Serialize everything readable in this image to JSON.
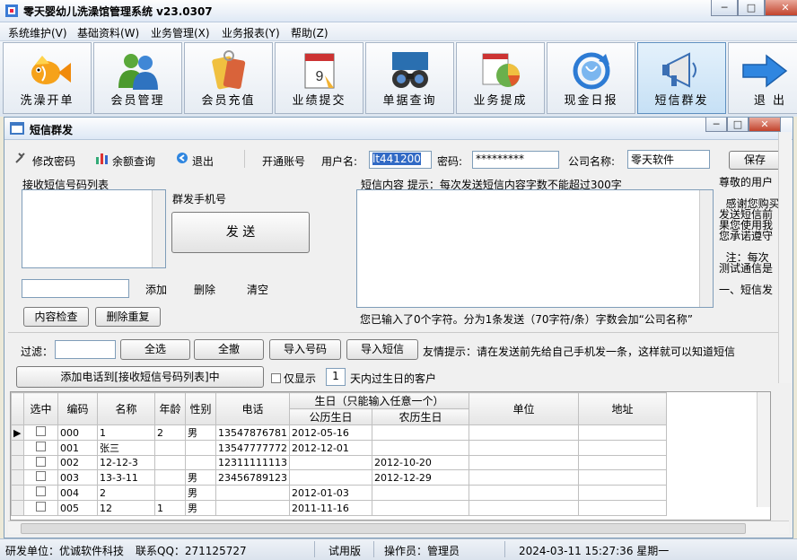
{
  "app": {
    "title": "零天婴幼儿洗澡馆管理系统  v23.0307"
  },
  "menu": [
    "系统维护(V)",
    "基础资料(W)",
    "业务管理(X)",
    "业务报表(Y)",
    "帮助(Z)"
  ],
  "toolbar": [
    {
      "label": "洗澡开单",
      "icon": "goldfish-icon"
    },
    {
      "label": "会员管理",
      "icon": "users-icon"
    },
    {
      "label": "会员充值",
      "icon": "tags-icon"
    },
    {
      "label": "业绩提交",
      "icon": "calendar-icon"
    },
    {
      "label": "单据查询",
      "icon": "binoculars-icon"
    },
    {
      "label": "业务提成",
      "icon": "pie-chart-icon"
    },
    {
      "label": "现金日报",
      "icon": "globe-refresh-icon"
    },
    {
      "label": "短信群发",
      "icon": "megaphone-icon"
    },
    {
      "label": "退 出",
      "icon": "arrow-right-icon"
    }
  ],
  "sms": {
    "title": "短信群发",
    "change_pwd": "修改密码",
    "balance": "余额查询",
    "exit": "退出",
    "open_account": "开通账号",
    "username_label": "用户名:",
    "username_value": "lt441200",
    "password_label": "密码:",
    "password_value": "*********",
    "company_label": "公司名称:",
    "company_value": "零天软件",
    "save": "保存",
    "recv_list_label": "接收短信号码列表",
    "group_phone_label": "群发手机号",
    "send": "发 送",
    "add": "添加",
    "delete": "删除",
    "clear": "清空",
    "content_check": "内容检查",
    "delete_dup": "删除重复",
    "content_label": "短信内容  提示：每次发送短信内容字数不能超过300字",
    "count_text": "您已输入了0个字符。分为1条发送（70字符/条）字数会加“公司名称”",
    "notice_lines": [
      "尊敬的用户",
      "",
      "  感谢您购买",
      "发送短信前",
      "果您使用我",
      "您承诺遵守",
      "",
      "  注：每次",
      "测试通信是",
      "",
      "一、短信发"
    ],
    "filter_label": "过滤：",
    "select_all": "全选",
    "deselect_all": "全撤",
    "import_numbers": "导入号码",
    "import_sms": "导入短信",
    "tip": "友情提示：请在发送前先给自己手机发一条，这样就可以知道短信",
    "add_to_list": "添加电话到[接收短信号码列表]中",
    "only_show": "仅显示",
    "days_value": "1",
    "days_suffix": "天内过生日的客户"
  },
  "table": {
    "headers": {
      "select": "选中",
      "code": "编码",
      "name": "名称",
      "age": "年龄",
      "gender": "性别",
      "phone": "电话",
      "birthday_group": "生日（只能输入任意一个）",
      "solar": "公历生日",
      "lunar": "农历生日",
      "unit": "单位",
      "address": "地址"
    },
    "rows": [
      {
        "code": "000",
        "name": "1",
        "age": "2",
        "gender": "男",
        "phone": "13547876781",
        "solar": "2012-05-16",
        "lunar": "",
        "unit": "",
        "address": ""
      },
      {
        "code": "001",
        "name": "张三",
        "age": "",
        "gender": "",
        "phone": "13547777772",
        "solar": "2012-12-01",
        "lunar": "",
        "unit": "",
        "address": ""
      },
      {
        "code": "002",
        "name": "12-12-3",
        "age": "",
        "gender": "",
        "phone": "12311111113",
        "solar": "",
        "lunar": "2012-10-20",
        "unit": "",
        "address": ""
      },
      {
        "code": "003",
        "name": "13-3-11",
        "age": "",
        "gender": "男",
        "phone": "23456789123",
        "solar": "",
        "lunar": "2012-12-29",
        "unit": "",
        "address": ""
      },
      {
        "code": "004",
        "name": "2",
        "age": "",
        "gender": "男",
        "phone": "",
        "solar": "2012-01-03",
        "lunar": "",
        "unit": "",
        "address": ""
      },
      {
        "code": "005",
        "name": "12",
        "age": "1",
        "gender": "男",
        "phone": "",
        "solar": "2011-11-16",
        "lunar": "",
        "unit": "",
        "address": ""
      }
    ]
  },
  "status": {
    "developer": "研发单位：优诚软件科技",
    "qq": "联系QQ：271125727",
    "edition": "试用版",
    "operator": "操作员：管理员",
    "datetime": "2024-03-11 15:27:36 星期一"
  }
}
